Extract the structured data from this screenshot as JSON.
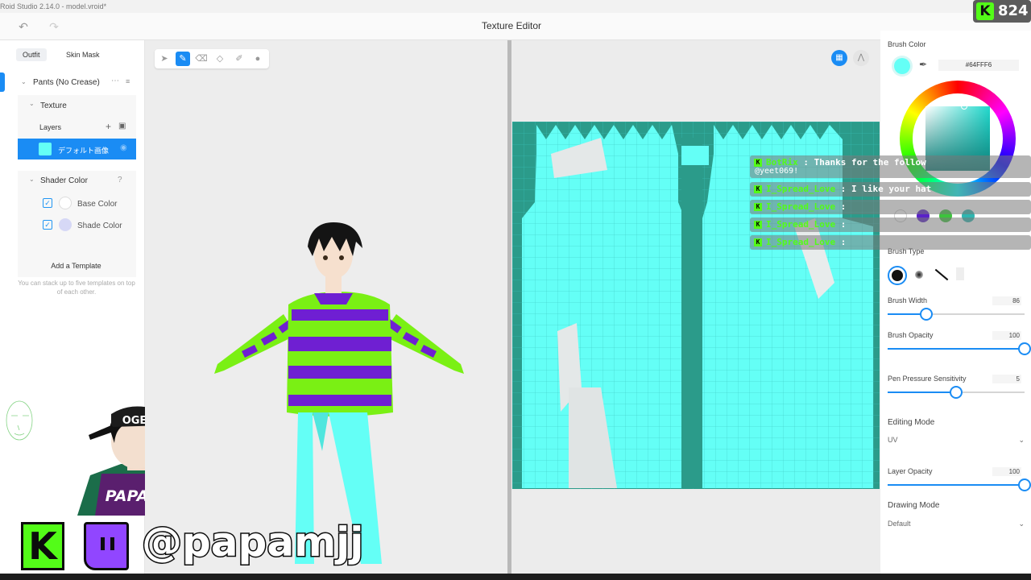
{
  "window": {
    "title": "Roid Studio 2.14.0 - model.vroid*",
    "panel_title": "Texture Editor"
  },
  "left_panel": {
    "tabs": [
      "Outfit",
      "Skin Mask"
    ],
    "item_title": "Pants (No Crease)",
    "texture_label": "Texture",
    "layers_label": "Layers",
    "layer_name": "デフォルト画像",
    "shader_label": "Shader Color",
    "base_color_label": "Base Color",
    "shade_color_label": "Shade Color",
    "add_template_label": "Add a Template",
    "template_hint": "You can stack up to five templates on top of each other.",
    "colors": {
      "layer_swatch": "#64FFF6",
      "base": "#FFFFFF",
      "shade": "#D6D8F6",
      "accent": "#1A8CF4"
    }
  },
  "right_panel": {
    "brush_color_label": "Brush Color",
    "brush_color_hex": "#64FFF6",
    "recent_colors": [
      "#FFFFFF",
      "#5A22C8",
      "#3CC43C",
      "#2EB6B0"
    ],
    "brush_type_label": "Brush Type",
    "brush_width_label": "Brush Width",
    "brush_width_value": "86",
    "brush_width_fraction": 0.28,
    "brush_opacity_label": "Brush Opacity",
    "brush_opacity_value": "100",
    "brush_opacity_fraction": 1.0,
    "pen_pressure_label": "Pen Pressure Sensitivity",
    "pen_pressure_value": "5",
    "pen_pressure_fraction": 0.5,
    "editing_mode_label": "Editing Mode",
    "editing_mode_value": "UV",
    "layer_opacity_label": "Layer Opacity",
    "layer_opacity_value": "100",
    "layer_opacity_fraction": 1.0,
    "drawing_mode_label": "Drawing Mode",
    "drawing_mode_value": "Default"
  },
  "chat": {
    "messages": [
      {
        "user": "BotRix",
        "text": "Thanks for the follow",
        "extra": "@yeet069!"
      },
      {
        "user": "I_Spread_Love",
        "text": "I like your hat"
      },
      {
        "user": "I_Spread_Love",
        "text": ""
      },
      {
        "user": "I_Spread_Love",
        "text": ""
      },
      {
        "user": "I_Spread_Love",
        "text": ""
      }
    ],
    "separator": ":"
  },
  "overlay": {
    "viewer_count": "824",
    "handle": "@papamjj",
    "shirt_text": "PAPAMJJ",
    "cap_text": "OGER",
    "kick_color": "#53FC18",
    "twitch_color": "#9146FF"
  },
  "icons": {
    "undo": "undo-icon",
    "redo": "redo-icon",
    "select": "select-tool-icon",
    "pen": "pen-tool-icon",
    "eraser": "eraser-tool-icon",
    "fill": "fill-tool-icon",
    "picker": "picker-tool-icon",
    "blur": "blur-tool-icon"
  }
}
